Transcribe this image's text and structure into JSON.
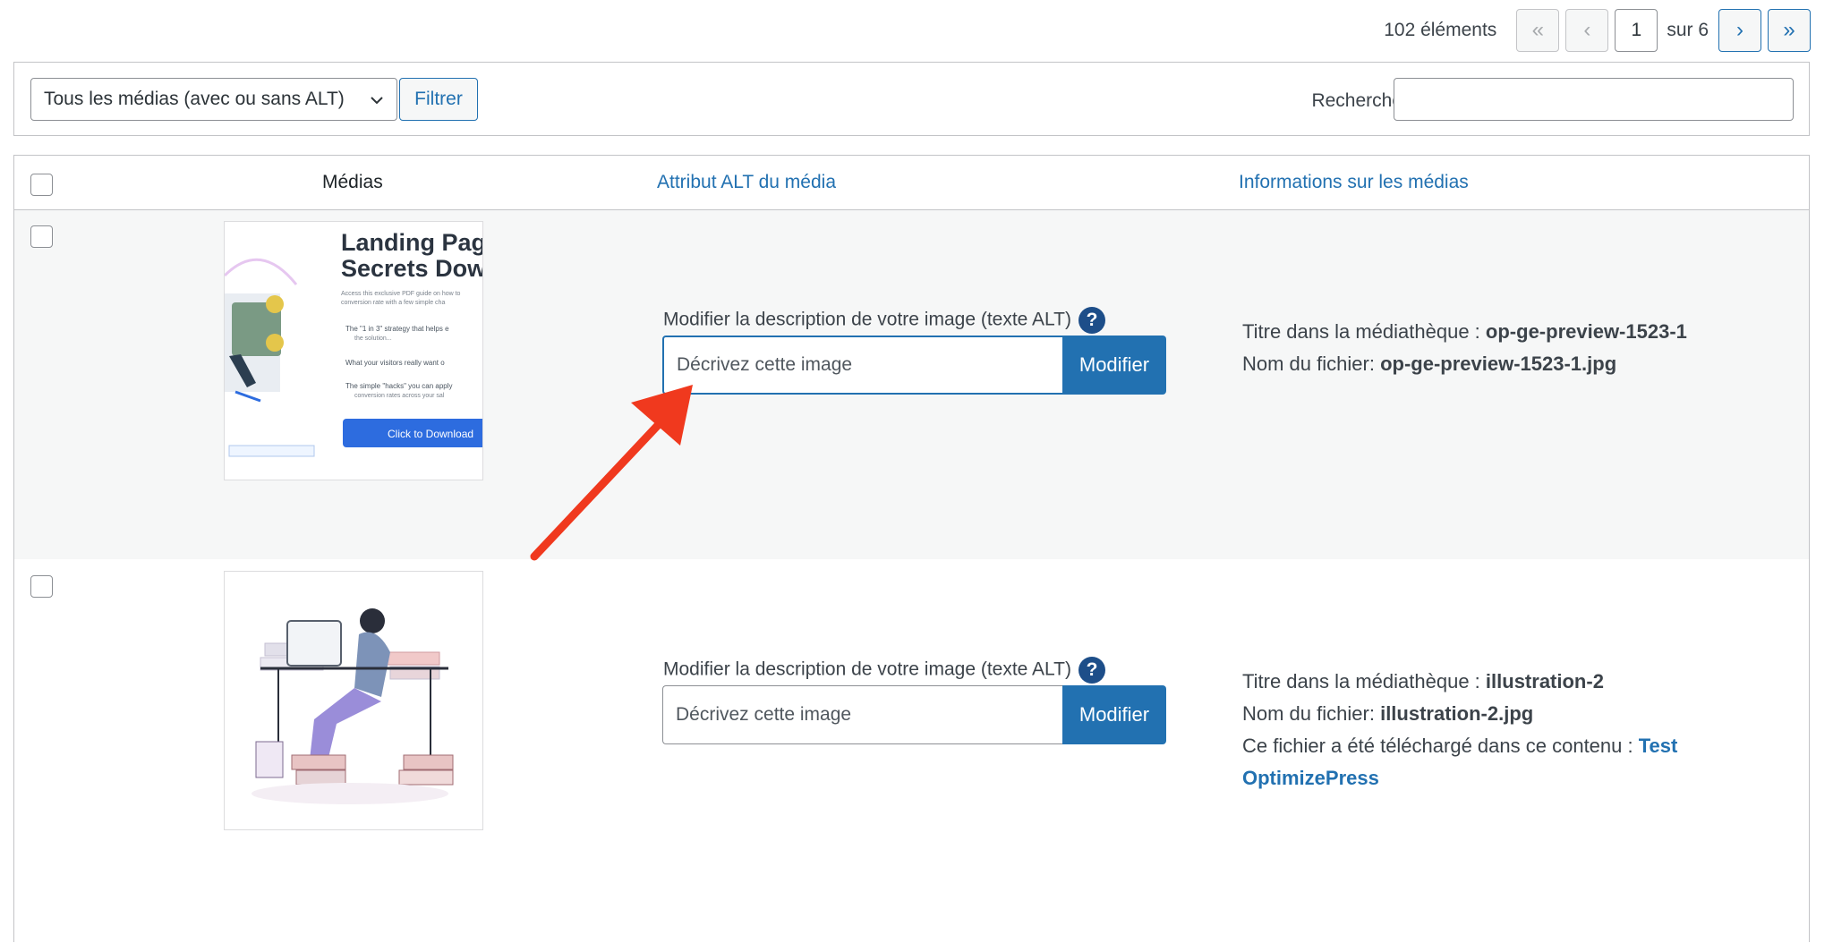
{
  "pagination": {
    "count": "102 éléments",
    "first": "«",
    "prev": "‹",
    "current_page": "1",
    "of_label": "sur 6",
    "next": "›",
    "last": "»"
  },
  "filters": {
    "select_value": "Tous les médias (avec ou sans ALT)",
    "filter_button": "Filtrer",
    "search_label": "Rechercher",
    "search_value": ""
  },
  "table": {
    "columns": [
      "Médias",
      "Attribut ALT du média",
      "Informations sur les médias"
    ],
    "rows": [
      {
        "alt_label": "Modifier la description de votre image (texte ALT)",
        "alt_help": "?",
        "alt_placeholder": "Décrivez cette image",
        "alt_button": "Modifier",
        "title_label": "Titre dans la médiathèque :",
        "title_value": "op-ge-preview-1523-1",
        "file_label": "Nom du fichier:",
        "file_value": "op-ge-preview-1523-1.jpg",
        "thumb": {
          "heading_line1": "Landing Page",
          "heading_line2": "Secrets Down",
          "intro": "Access this exclusive PDF guide on how to",
          "intro2": "conversion rate with a few simple cha",
          "bullet1": "The \"1 in 3\" strategy that helps e",
          "bullet1b": "the solution...",
          "bullet2": "What your visitors really want o",
          "bullet3": "The simple \"hacks\" you can apply",
          "bullet3b": "conversion rates across your sal",
          "cta": "Click to Download",
          "badge": "+ $ $"
        }
      },
      {
        "alt_label": "Modifier la description de votre image (texte ALT)",
        "alt_help": "?",
        "alt_placeholder": "Décrivez cette image",
        "alt_button": "Modifier",
        "title_label": "Titre dans la médiathèque :",
        "title_value": "illustration-2",
        "file_label": "Nom du fichier:",
        "file_value": "illustration-2.jpg",
        "uploaded_label": "Ce fichier a été téléchargé dans ce contenu :",
        "uploaded_link_line1": "Test",
        "uploaded_link_line2": "OptimizePress"
      }
    ]
  },
  "colors": {
    "accent": "#2271b1",
    "help_icon": "#1d4e89",
    "annotation_arrow": "#f0391e",
    "row_alt_bg": "#f6f7f7"
  }
}
